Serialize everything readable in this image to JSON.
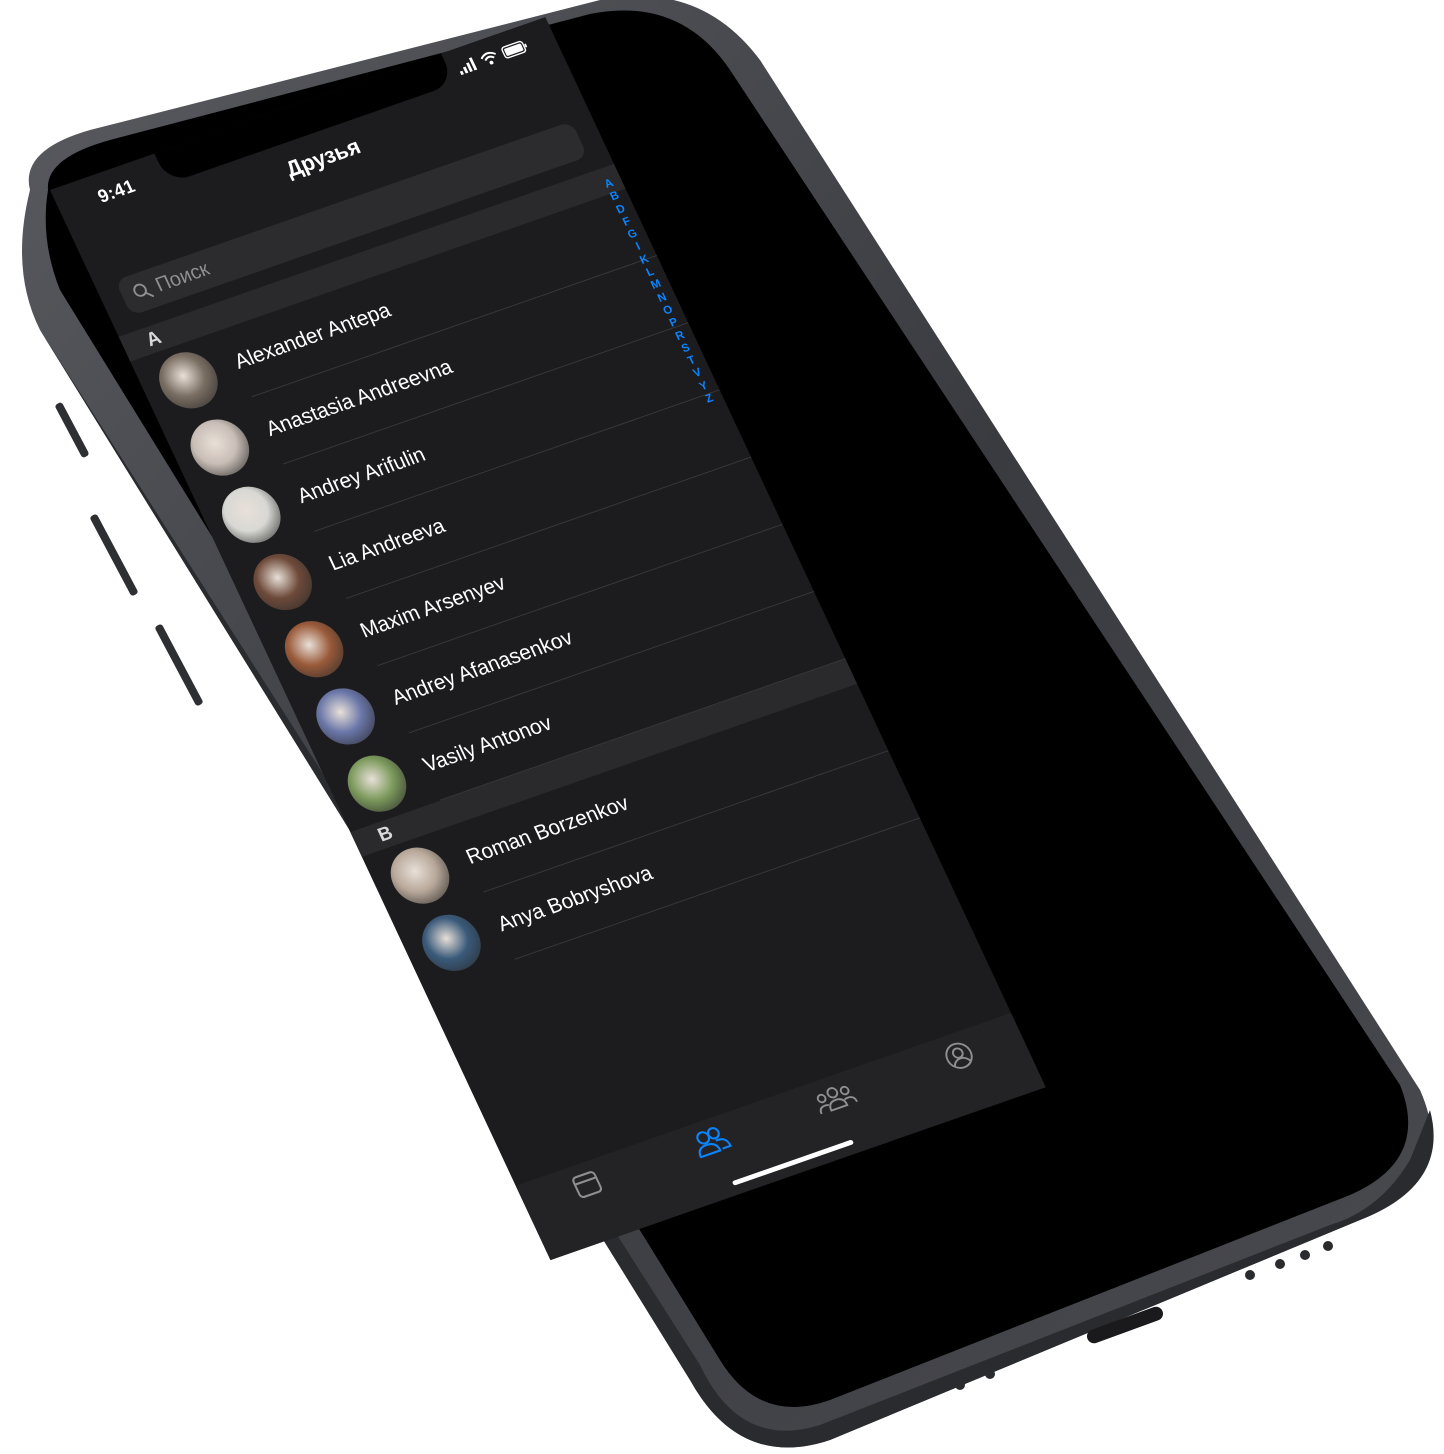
{
  "status_bar": {
    "time": "9:41"
  },
  "nav": {
    "title": "Друзья"
  },
  "search": {
    "placeholder": "Поиск",
    "icon": "search-icon"
  },
  "sections": [
    {
      "letter": "A",
      "friends": [
        {
          "name": "Alexander Antepa",
          "avatar_color": "#7a6e62"
        },
        {
          "name": "Anastasia Andreevna",
          "avatar_color": "#c9beb7"
        },
        {
          "name": "Andrey Arifulin",
          "avatar_color": "#d8d8d4"
        },
        {
          "name": "Lia Andreeva",
          "avatar_color": "#6e4a3a"
        },
        {
          "name": "Maxim Arsenyev",
          "avatar_color": "#9a5a3a"
        },
        {
          "name": "Andrey Afanasenkov",
          "avatar_color": "#6a76a8"
        },
        {
          "name": "Vasily Antonov",
          "avatar_color": "#7c9a5c"
        }
      ]
    },
    {
      "letter": "B",
      "friends": [
        {
          "name": "Roman Borzenkov",
          "avatar_color": "#b8a89a"
        },
        {
          "name": "Anya Bobryshova",
          "avatar_color": "#3a5a7a"
        }
      ]
    }
  ],
  "index_letters": [
    "A",
    "B",
    "D",
    "F",
    "G",
    "I",
    "K",
    "L",
    "M",
    "N",
    "O",
    "P",
    "R",
    "S",
    "T",
    "V",
    "Y",
    "Z"
  ],
  "tab_bar": {
    "tabs": [
      {
        "icon": "news-feed-icon",
        "active": false
      },
      {
        "icon": "friends-icon",
        "active": true
      },
      {
        "icon": "groups-icon",
        "active": false
      },
      {
        "icon": "profile-icon",
        "active": false
      }
    ],
    "active_color": "#0a84ff",
    "inactive_color": "#8e8e93"
  }
}
